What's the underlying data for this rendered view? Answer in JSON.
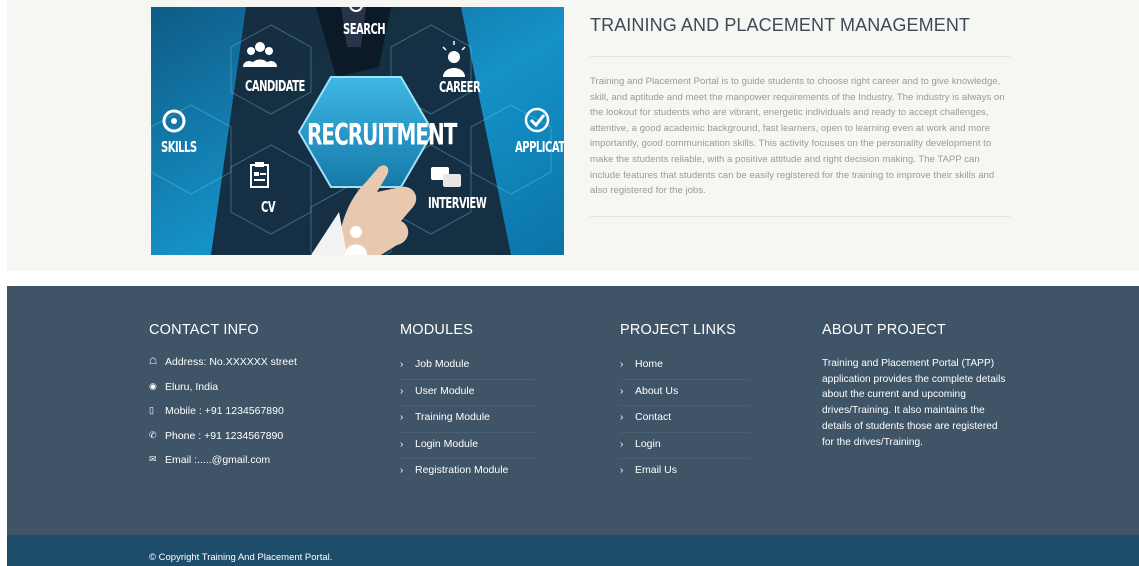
{
  "hero": {
    "labels": {
      "search": "SEARCH",
      "candidate": "CANDIDATE",
      "career": "CAREER",
      "skills": "SKILLS",
      "application": "APPLICATION",
      "cv": "CV",
      "interview": "INTERVIEW",
      "recruitment": "RECRUITMENT"
    }
  },
  "about": {
    "title": "TRAINING AND PLACEMENT MANAGEMENT",
    "description": "Training and Placement Portal is to guide students to choose right career and to give knowledge, skill, and aptitude and meet the manpower requirements of the Industry. The industry is always on the lookout for students who are vibrant, energetic individuals and ready to accept challenges, attentive, a good academic background, fast learners, open to learning even at work and more importantly, good communication skills. This activity focuses on the personality development to make the students reliable, with a positive attitude and right decision making. The TAPP can include features that students can be easily registered for the training to improve their skills and also registered for the jobs."
  },
  "footer": {
    "contact": {
      "title": "CONTACT INFO",
      "items": [
        {
          "icon": "home-icon",
          "text": "Address: No.XXXXXX street"
        },
        {
          "icon": "globe-icon",
          "text": "Eluru, India"
        },
        {
          "icon": "mobile-icon",
          "text": "Mobile : +91 1234567890"
        },
        {
          "icon": "phone-icon",
          "text": "Phone : +91 1234567890"
        },
        {
          "icon": "envelope-icon",
          "text": "Email :.....@gmail.com"
        }
      ]
    },
    "modules": {
      "title": "MODULES",
      "items": [
        "Job Module",
        "User Module",
        "Training Module",
        "Login Module",
        "Registration Module"
      ]
    },
    "project_links": {
      "title": "PROJECT LINKS",
      "items": [
        "Home",
        "About Us",
        "Contact",
        "Login",
        "Email Us"
      ]
    },
    "about_project": {
      "title": "ABOUT PROJECT",
      "text": "Training and Placement Portal (TAPP) application provides the complete details about the current and upcoming drives/Training. It also maintains the details of students those are registered for the drives/Training."
    }
  },
  "bottom": {
    "copyright": "© Copyright Training And Placement Portal."
  },
  "colors": {
    "about_bg": "#f6f6f3",
    "footer_bg": "#3f5466",
    "bottom_bar_bg": "#1e4d6c",
    "hero_blue": "#1c9ad1"
  }
}
